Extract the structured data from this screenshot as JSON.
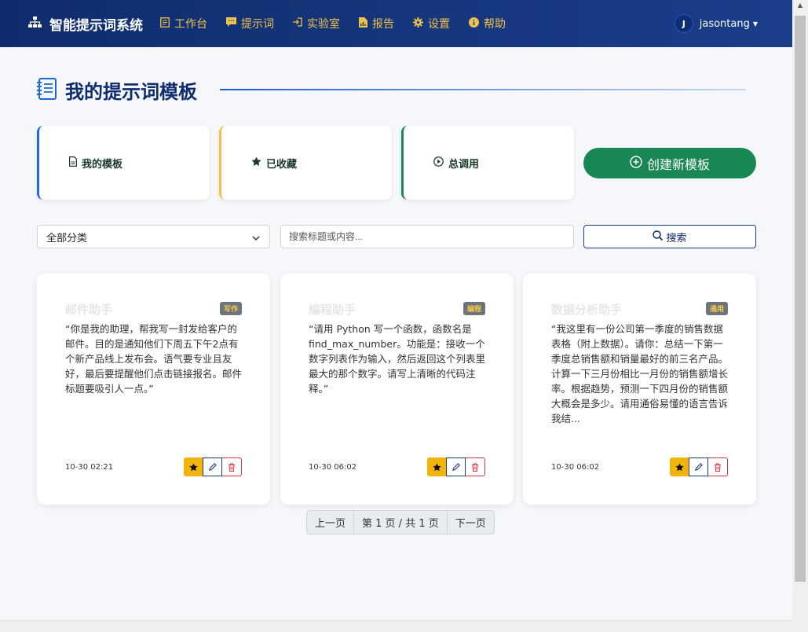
{
  "navbar": {
    "brand": "智能提示词系统",
    "items": [
      {
        "label": "工作台",
        "icon": "workbench-icon"
      },
      {
        "label": "提示词",
        "icon": "chat-icon"
      },
      {
        "label": "实验室",
        "icon": "login-icon"
      },
      {
        "label": "报告",
        "icon": "report-icon"
      },
      {
        "label": "设置",
        "icon": "gear-icon"
      },
      {
        "label": "帮助",
        "icon": "info-icon"
      }
    ],
    "user": {
      "avatar_letter": "J",
      "name": "jasontang"
    }
  },
  "page": {
    "title": "我的提示词模板"
  },
  "stats": [
    {
      "label": "我的模板",
      "accent": "#1b6bd8"
    },
    {
      "label": "已收藏",
      "accent": "#f0c24a"
    },
    {
      "label": "总调用",
      "accent": "#198754"
    }
  ],
  "create_button": "创建新模板",
  "filters": {
    "category": "全部分类",
    "search_placeholder": "搜索标题或内容...",
    "search_button": "搜索"
  },
  "cards": [
    {
      "title": "邮件助手",
      "tag": "写作",
      "body": "“你是我的助理，帮我写一封发给客户的邮件。目的是通知他们下周五下午2点有个新产品线上发布会。语气要专业且友好，最后要提醒他们点击链接报名。邮件标题要吸引人一点。”",
      "time": "10-30 02:21"
    },
    {
      "title": "编程助手",
      "tag": "编程",
      "body": "“请用 Python 写一个函数，函数名是 find_max_number。功能是：接收一个数字列表作为输入，然后返回这个列表里最大的那个数字。请写上清晰的代码注释。”",
      "time": "10-30 06:02"
    },
    {
      "title": "数据分析助手",
      "tag": "通用",
      "body": "“我这里有一份公司第一季度的销售数据表格（附上数据）。请你：总结一下第一季度总销售额和销量最好的前三名产品。计算一下三月份相比一月份的销售额增长率。根据趋势，预测一下四月份的销售额大概会是多少。请用通俗易懂的语言告诉我结...",
      "time": "10-30 06:02"
    }
  ],
  "pagination": {
    "prev": "上一页",
    "info": "第 1 页 / 共 1 页",
    "next": "下一页"
  }
}
